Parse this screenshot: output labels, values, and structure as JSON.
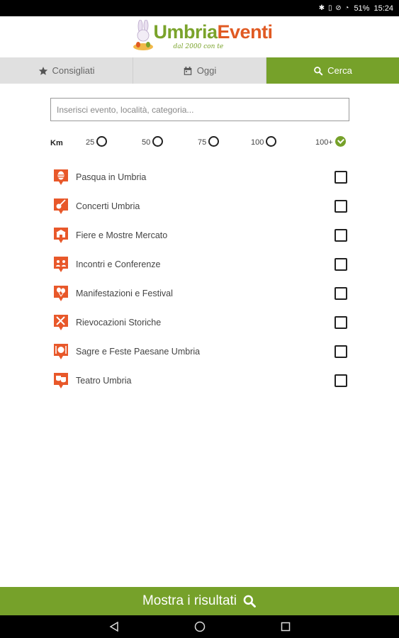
{
  "status_bar": {
    "icons": "✱ ▯ ⊘ ◔",
    "battery": "51%",
    "time": "15:24"
  },
  "logo": {
    "brand_part1": "Umbria",
    "brand_part2": "Eventi",
    "tagline": "dal 2000 con te"
  },
  "tabs": [
    {
      "label": "Consigliati",
      "icon": "star-icon",
      "active": false
    },
    {
      "label": "Oggi",
      "icon": "calendar-icon",
      "active": false
    },
    {
      "label": "Cerca",
      "icon": "search-icon",
      "active": true
    }
  ],
  "search": {
    "placeholder": "Inserisci evento, località, categoria..."
  },
  "distance": {
    "label": "Km",
    "options": [
      {
        "value": "25",
        "checked": false
      },
      {
        "value": "50",
        "checked": false
      },
      {
        "value": "75",
        "checked": false
      },
      {
        "value": "100",
        "checked": false
      },
      {
        "value": "100+",
        "checked": true
      }
    ]
  },
  "categories": [
    {
      "label": "Pasqua in Umbria",
      "icon": "easter-egg-icon",
      "checked": false
    },
    {
      "label": "Concerti Umbria",
      "icon": "guitar-icon",
      "checked": false
    },
    {
      "label": "Fiere e Mostre Mercato",
      "icon": "market-icon",
      "checked": false
    },
    {
      "label": "Incontri e Conferenze",
      "icon": "people-icon",
      "checked": false
    },
    {
      "label": "Manifestazioni e Festival",
      "icon": "balloons-icon",
      "checked": false
    },
    {
      "label": "Rievocazioni Storiche",
      "icon": "swords-icon",
      "checked": false
    },
    {
      "label": "Sagre e Feste Paesane Umbria",
      "icon": "cutlery-icon",
      "checked": false
    },
    {
      "label": "Teatro Umbria",
      "icon": "theater-masks-icon",
      "checked": false
    }
  ],
  "results_button": {
    "label": "Mostra i risultati",
    "icon": "search-icon"
  },
  "colors": {
    "accent_green": "#76a12a",
    "category_orange": "#e8582a"
  }
}
